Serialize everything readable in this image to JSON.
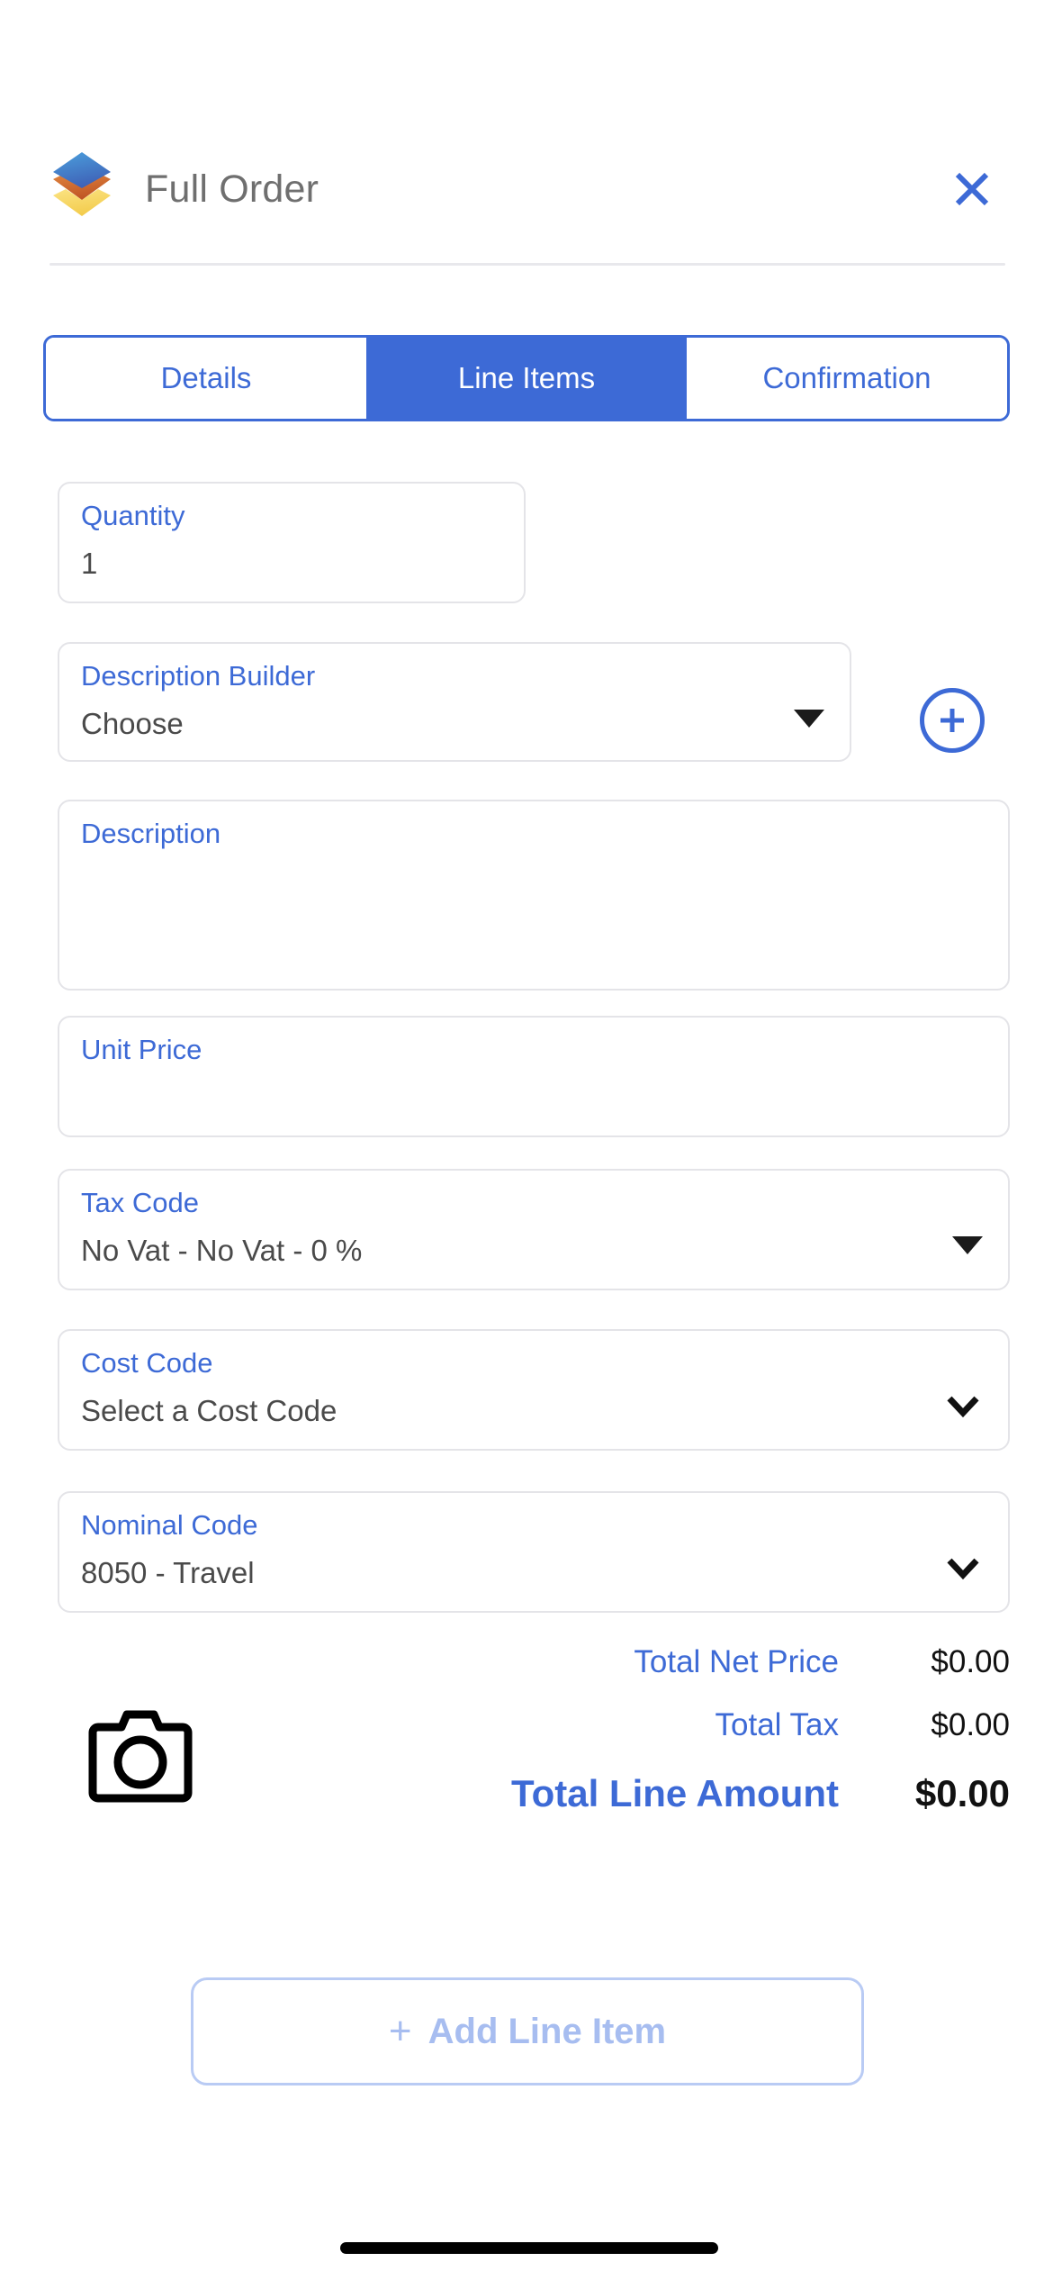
{
  "header": {
    "title": "Full Order",
    "logo_colors": {
      "top": "#3f8fd0",
      "middle": "#c9632a",
      "bottom": "#f5d75e"
    },
    "close_label": "×"
  },
  "theme": {
    "accent": "#3d6ad6",
    "accent_muted": "#a7bdf0",
    "border": "#e4e4e8",
    "text_dark": "#4a4a4a",
    "title_gray": "#6f6f6f"
  },
  "tabs": [
    {
      "label": "Details",
      "active": false
    },
    {
      "label": "Line Items",
      "active": true
    },
    {
      "label": "Confirmation",
      "active": false
    }
  ],
  "form": {
    "quantity": {
      "label": "Quantity",
      "value": "1"
    },
    "description_builder": {
      "label": "Description Builder",
      "value": "Choose",
      "caret": "solid-down-triangle"
    },
    "add_description_button": "+",
    "description": {
      "label": "Description",
      "value": ""
    },
    "unit_price": {
      "label": "Unit Price",
      "value": ""
    },
    "tax_code": {
      "label": "Tax Code",
      "value": "No Vat - No Vat - 0 %",
      "caret": "solid-down-triangle"
    },
    "cost_code": {
      "label": "Cost Code",
      "value": "Select a Cost Code",
      "caret": "chevron-down"
    },
    "nominal_code": {
      "label": "Nominal Code",
      "value": "8050 - Travel",
      "caret": "chevron-down"
    }
  },
  "totals": {
    "net_price_label": "Total Net Price",
    "net_price_value": "$0.00",
    "tax_label": "Total Tax",
    "tax_value": "$0.00",
    "line_amount_label": "Total Line Amount",
    "line_amount_value": "$0.00"
  },
  "actions": {
    "add_line_item_plus": "+",
    "add_line_item_label": "Add Line Item"
  }
}
